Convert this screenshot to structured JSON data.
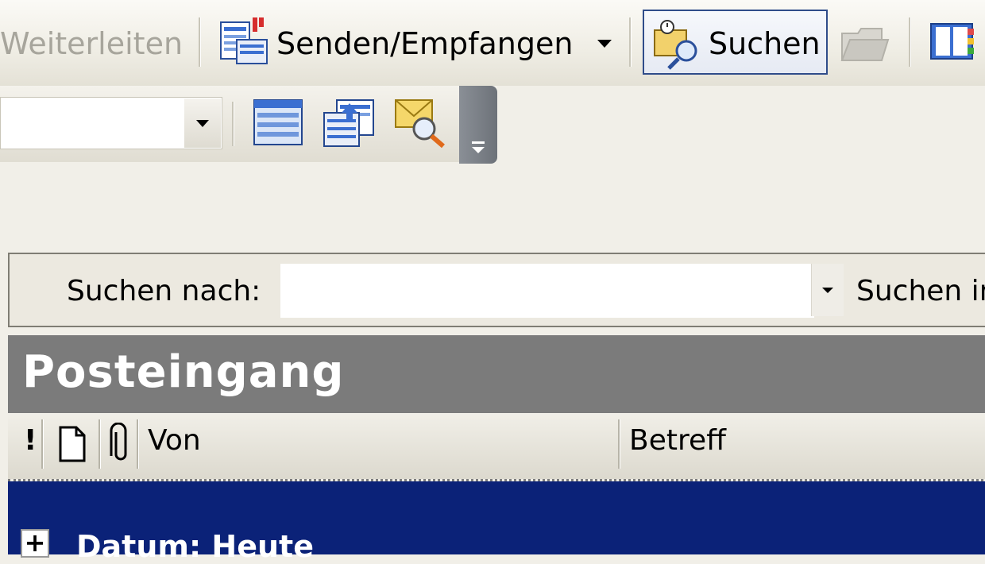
{
  "toolbar": {
    "forward_label": "Weiterleiten",
    "send_receive_label": "Senden/Empfangen",
    "search_label": "Suchen"
  },
  "icons": {
    "send_receive": "send-receive-icon",
    "search": "search-icon",
    "folder": "open-folder-icon",
    "address_book": "address-book-icon",
    "dropdown": "chevron-down-icon",
    "view": "view-list-icon",
    "organize": "organize-icon",
    "find_mail": "find-message-icon",
    "toolbar_options": "toolbar-options-icon"
  },
  "find_bar": {
    "label": "Suchen nach:",
    "value": "",
    "search_in_label": "Suchen in"
  },
  "folder": {
    "title": "Posteingang",
    "columns": {
      "importance": "!",
      "icon": "",
      "attachment": "",
      "from": "Von",
      "subject": "Betreff"
    },
    "group": {
      "expand_symbol": "+",
      "label": "Datum: Heute"
    }
  },
  "colors": {
    "toolbar_bg": "#efede4",
    "header_bg": "#7b7b7b",
    "selection_bg": "#0b2278",
    "accent_border": "#2f4c8a"
  }
}
